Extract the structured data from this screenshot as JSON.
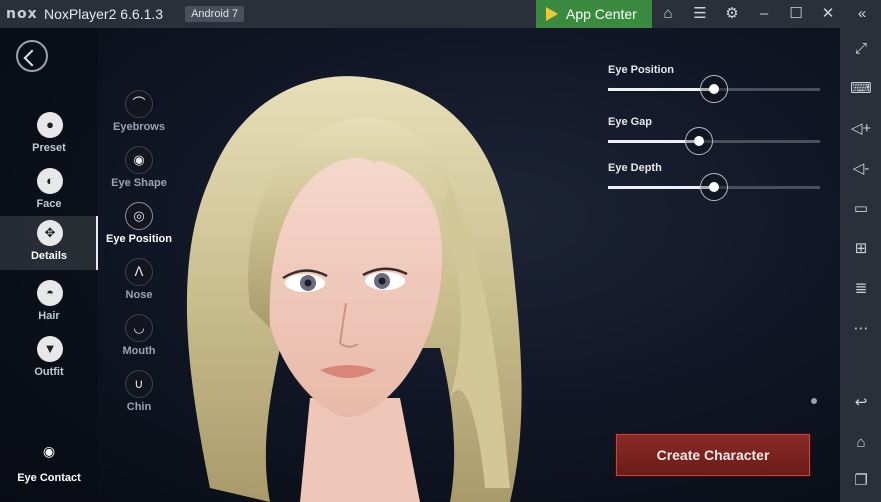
{
  "titlebar": {
    "logo": "nox",
    "title": "NoxPlayer2 6.6.1.3",
    "android_badge": "Android 7",
    "app_center": "App Center"
  },
  "titlebar_icons": [
    "shirt-icon",
    "menu-icon",
    "gear-icon",
    "minimize-icon",
    "maximize-icon",
    "close-icon",
    "collapse-icon"
  ],
  "right_toolbar": [
    "fullscreen-icon",
    "keyboard-icon",
    "volume-up-icon",
    "volume-down-icon",
    "screen-icon",
    "apk-icon",
    "multi-instance-icon",
    "more-icon",
    "back-icon",
    "home-icon",
    "recents-icon"
  ],
  "game": {
    "categories": [
      {
        "label": "Preset"
      },
      {
        "label": "Face"
      },
      {
        "label": "Details",
        "active": true
      },
      {
        "label": "Hair"
      },
      {
        "label": "Outfit"
      }
    ],
    "subcategories": [
      {
        "label": "Eyebrows"
      },
      {
        "label": "Eye Shape"
      },
      {
        "label": "Eye Position",
        "active": true
      },
      {
        "label": "Nose"
      },
      {
        "label": "Mouth"
      },
      {
        "label": "Chin"
      }
    ],
    "eye_contact": "Eye Contact",
    "sliders": [
      {
        "label": "Eye Position",
        "value": 0.5
      },
      {
        "label": "Eye Gap",
        "value": 0.43
      },
      {
        "label": "Eye Depth",
        "value": 0.5
      }
    ],
    "create_button": "Create Character"
  }
}
